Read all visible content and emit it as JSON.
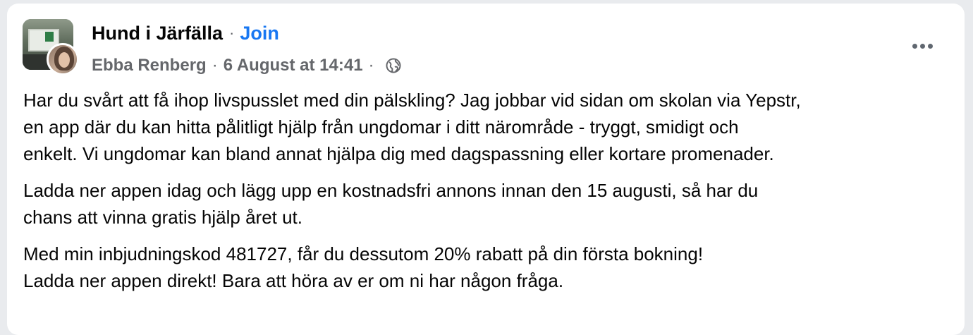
{
  "post": {
    "group_name": "Hund i Järfälla",
    "join_label": "Join",
    "separator": "·",
    "author": "Ebba Renberg",
    "timestamp": "6 August at 14:41",
    "privacy_icon": "globe-icon",
    "more_icon": "more-options-icon",
    "paragraphs": [
      [
        "Har du svårt att få ihop livspusslet med din pälskling? Jag jobbar vid sidan om skolan via Yepstr,",
        "en app där du kan hitta pålitligt hjälp från ungdomar i ditt närområde - tryggt, smidigt och",
        "enkelt. Vi ungdomar kan bland annat hjälpa dig med dagspassning eller kortare promenader."
      ],
      [
        "Ladda ner appen idag och lägg upp en kostnadsfri annons innan den 15 augusti, så har du",
        "chans att vinna gratis hjälp året ut."
      ],
      [
        "Med min inbjudningskod 481727, får du dessutom 20% rabatt på din första bokning!",
        "Ladda ner appen direkt! Bara att höra av er om ni har någon fråga."
      ]
    ]
  },
  "colors": {
    "link": "#1877f2",
    "secondary_text": "#65676b",
    "primary_text": "#050505",
    "card_background": "#ffffff"
  }
}
